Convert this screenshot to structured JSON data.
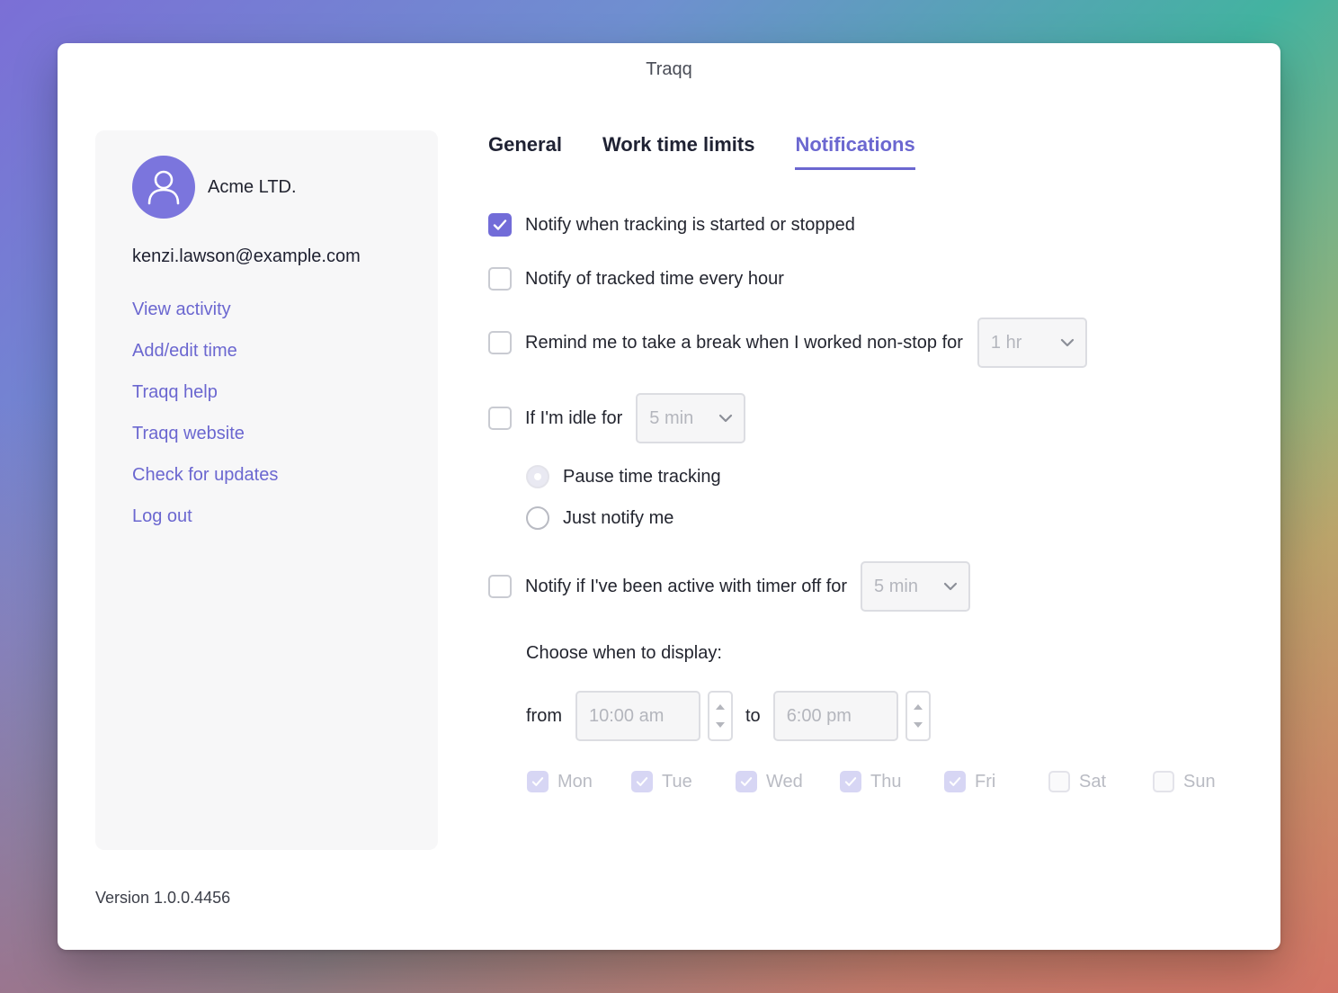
{
  "window": {
    "title": "Traqq"
  },
  "sidebar": {
    "org_name": "Acme LTD.",
    "email": "kenzi.lawson@example.com",
    "menu": [
      {
        "label": "View activity"
      },
      {
        "label": "Add/edit time"
      },
      {
        "label": "Traqq help"
      },
      {
        "label": "Traqq website"
      },
      {
        "label": "Check for updates"
      },
      {
        "label": "Log out"
      }
    ],
    "version": "Version 1.0.0.4456"
  },
  "tabs": [
    {
      "label": "General",
      "active": false
    },
    {
      "label": "Work time limits",
      "active": false
    },
    {
      "label": "Notifications",
      "active": true
    }
  ],
  "settings": {
    "notify_started_stopped": {
      "label": "Notify when tracking is started or stopped",
      "checked": true
    },
    "notify_every_hour": {
      "label": "Notify of tracked time every hour",
      "checked": false
    },
    "break_reminder": {
      "label": "Remind me to take a break when I worked non-stop for",
      "checked": false,
      "value": "1 hr"
    },
    "idle": {
      "label": "If I'm idle for",
      "checked": false,
      "value": "5 min",
      "options": [
        {
          "label": "Pause time tracking",
          "selected": true
        },
        {
          "label": "Just notify me",
          "selected": false
        }
      ]
    },
    "timer_off": {
      "label": "Notify if I've been active with timer off for",
      "checked": false,
      "value": "5 min"
    },
    "display": {
      "label": "Choose when to display:",
      "from_label": "from",
      "from_value": "10:00 am",
      "to_label": "to",
      "to_value": "6:00 pm",
      "days": [
        {
          "label": "Mon",
          "checked": true
        },
        {
          "label": "Tue",
          "checked": true
        },
        {
          "label": "Wed",
          "checked": true
        },
        {
          "label": "Thu",
          "checked": true
        },
        {
          "label": "Fri",
          "checked": true
        },
        {
          "label": "Sat",
          "checked": false
        },
        {
          "label": "Sun",
          "checked": false
        }
      ]
    }
  },
  "colors": {
    "accent": "#726cd8",
    "link": "#6b67d0",
    "disabled_text": "#b4b6bd"
  }
}
